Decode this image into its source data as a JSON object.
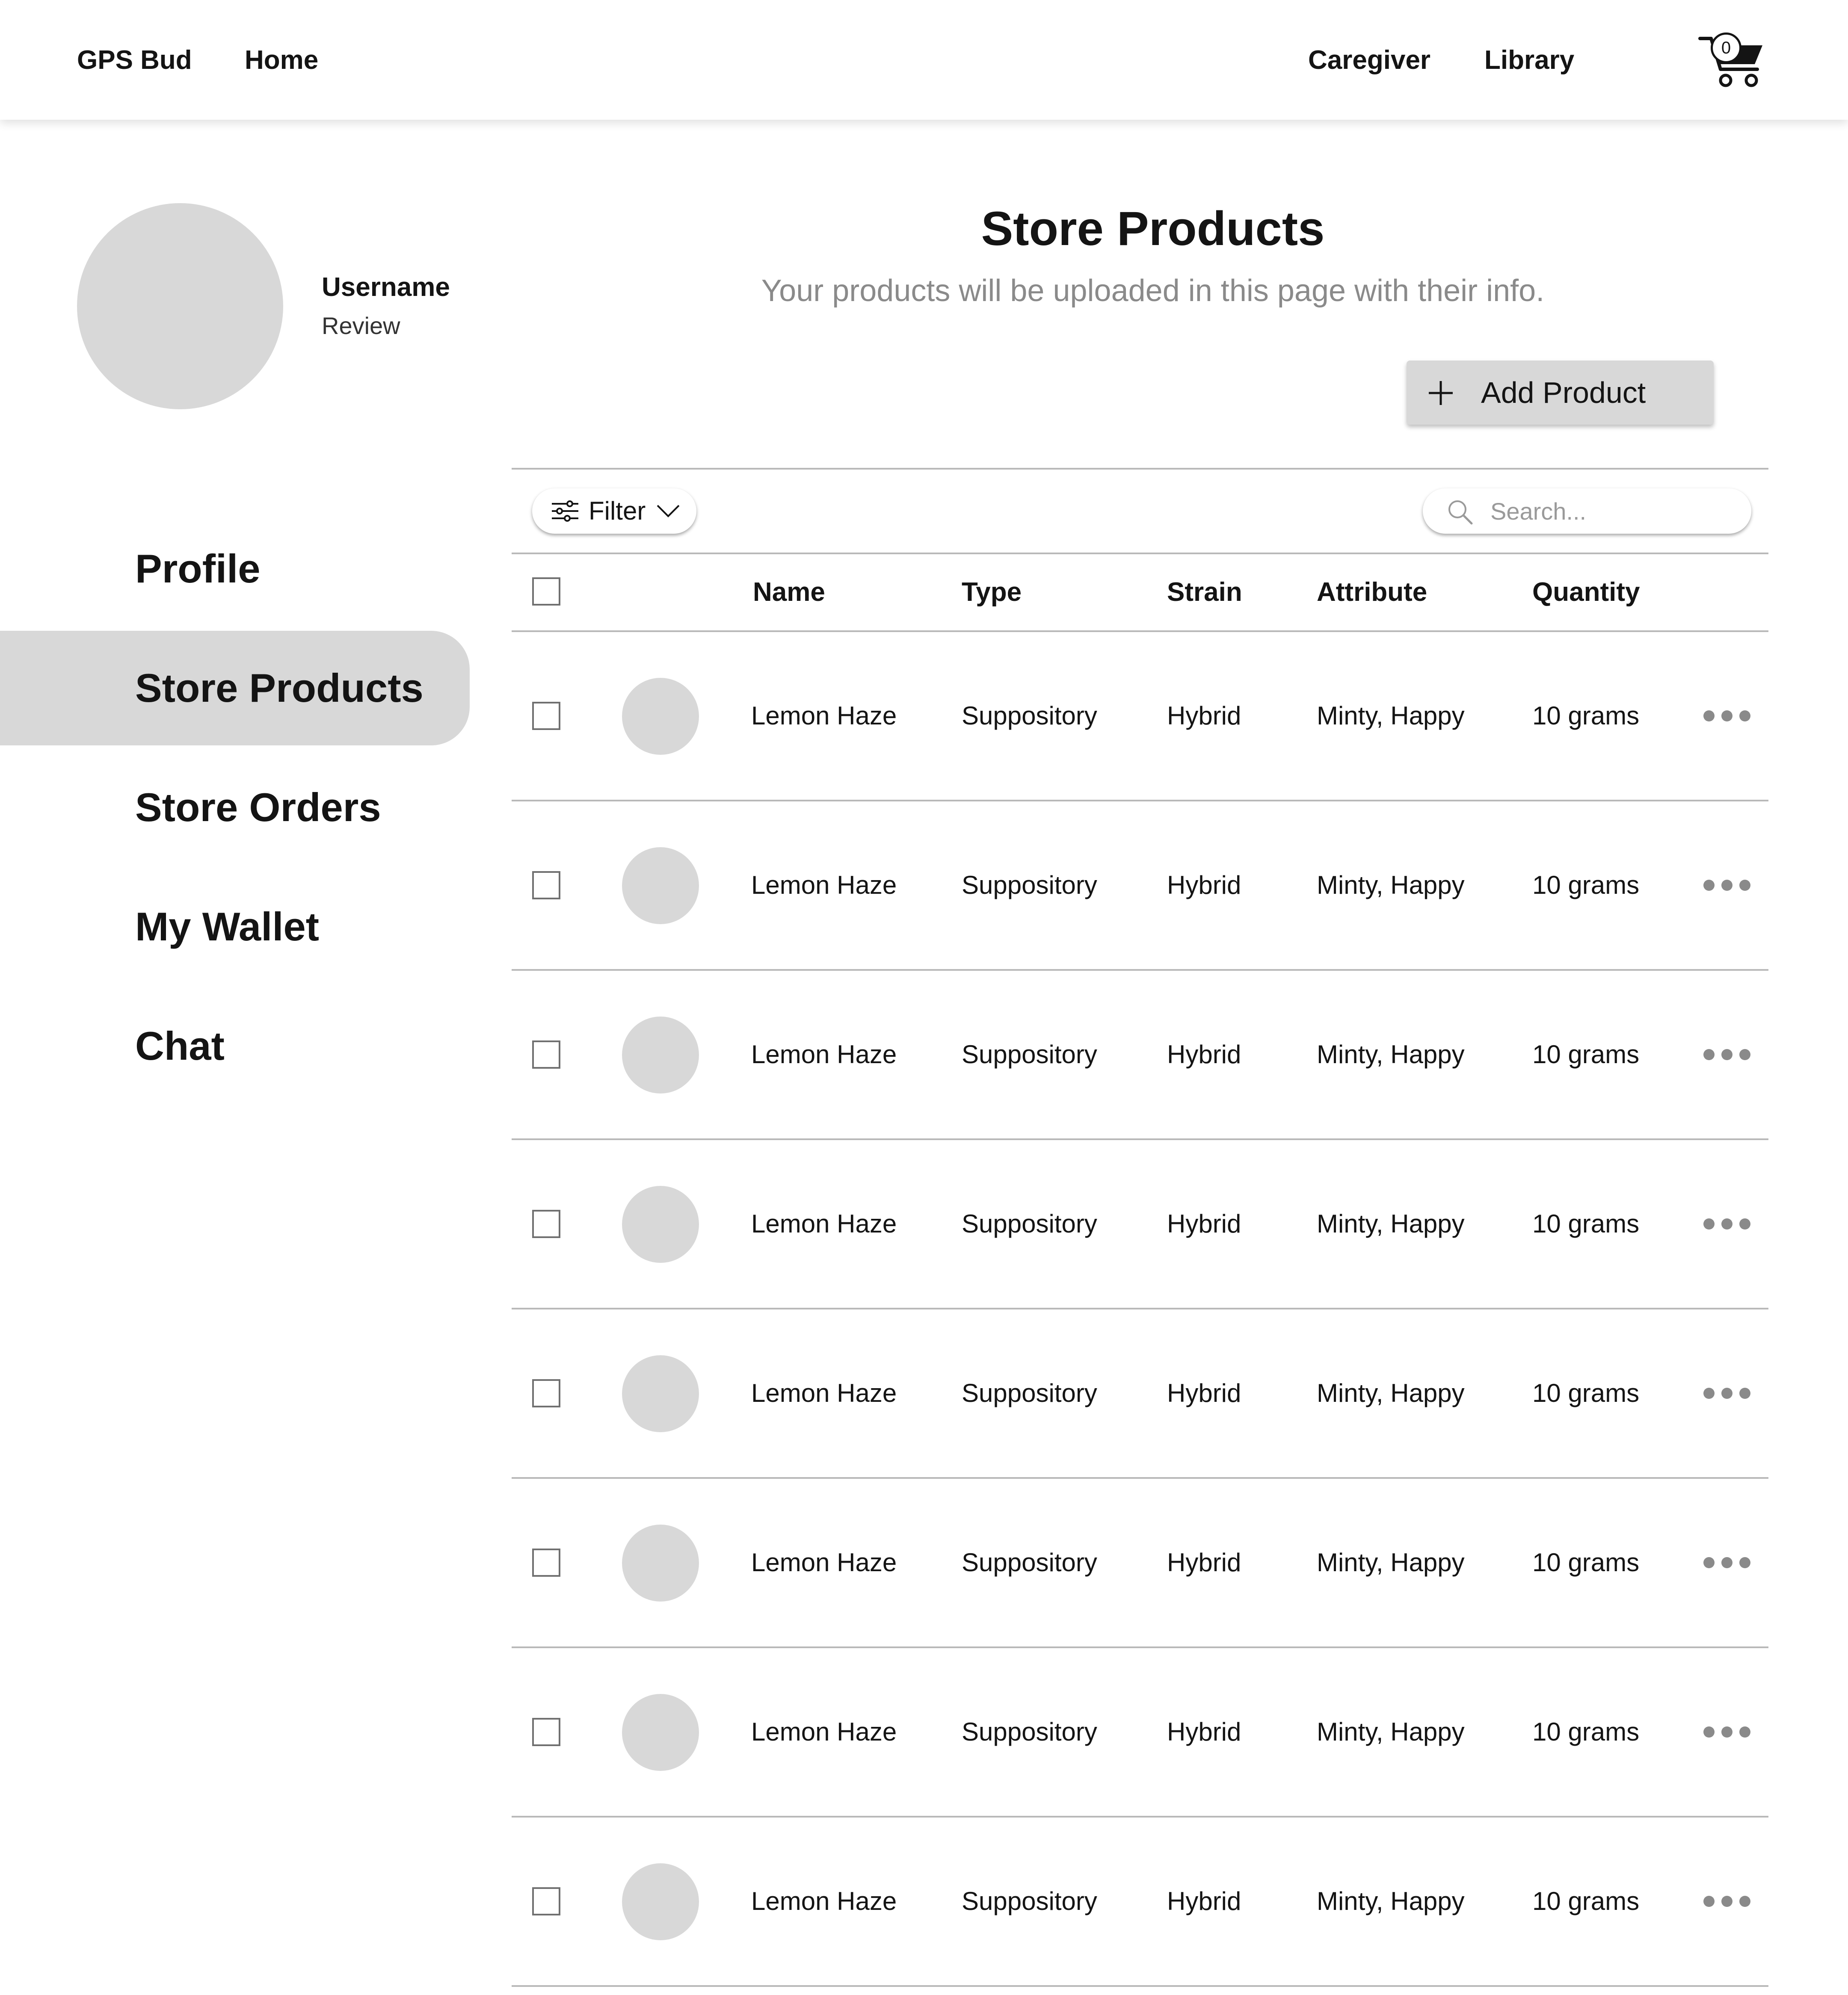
{
  "header": {
    "brand": "GPS Bud",
    "home": "Home",
    "caregiver": "Caregiver",
    "library": "Library",
    "cart_count": "0"
  },
  "profile": {
    "username": "Username",
    "subtitle": "Review"
  },
  "sidebar": {
    "items": [
      {
        "label": "Profile"
      },
      {
        "label": "Store Products"
      },
      {
        "label": "Store Orders"
      },
      {
        "label": "My Wallet"
      },
      {
        "label": "Chat"
      }
    ],
    "active": "Store Products"
  },
  "main": {
    "title": "Store Products",
    "subtitle": "Your products will be uploaded in this page with their info.",
    "add_button": "Add Product",
    "filter_label": "Filter",
    "search_placeholder": "Search...",
    "columns": [
      "Name",
      "Type",
      "Strain",
      "Attribute",
      "Quantity"
    ],
    "rows": [
      {
        "name": "Lemon Haze",
        "type": "Suppository",
        "strain": "Hybrid",
        "attribute": "Minty, Happy",
        "quantity": "10 grams"
      },
      {
        "name": "Lemon Haze",
        "type": "Suppository",
        "strain": "Hybrid",
        "attribute": "Minty, Happy",
        "quantity": "10 grams"
      },
      {
        "name": "Lemon Haze",
        "type": "Suppository",
        "strain": "Hybrid",
        "attribute": "Minty, Happy",
        "quantity": "10 grams"
      },
      {
        "name": "Lemon Haze",
        "type": "Suppository",
        "strain": "Hybrid",
        "attribute": "Minty, Happy",
        "quantity": "10 grams"
      },
      {
        "name": "Lemon Haze",
        "type": "Suppository",
        "strain": "Hybrid",
        "attribute": "Minty, Happy",
        "quantity": "10 grams"
      },
      {
        "name": "Lemon Haze",
        "type": "Suppository",
        "strain": "Hybrid",
        "attribute": "Minty, Happy",
        "quantity": "10 grams"
      },
      {
        "name": "Lemon Haze",
        "type": "Suppository",
        "strain": "Hybrid",
        "attribute": "Minty, Happy",
        "quantity": "10 grams"
      },
      {
        "name": "Lemon Haze",
        "type": "Suppository",
        "strain": "Hybrid",
        "attribute": "Minty, Happy",
        "quantity": "10 grams"
      }
    ]
  },
  "icons": {
    "cart": "cart-icon",
    "plus": "plus-icon",
    "filter": "filter-sliders-icon",
    "chevron": "chevron-down-icon",
    "search": "search-icon",
    "more": "more-horizontal-icon",
    "thumbnail": "product-thumbnail"
  },
  "colors": {
    "placeholder_gray": "#d8d8d8",
    "text": "#141414",
    "subtitle_gray": "#8a8a8a",
    "divider": "#b9b9b9"
  }
}
